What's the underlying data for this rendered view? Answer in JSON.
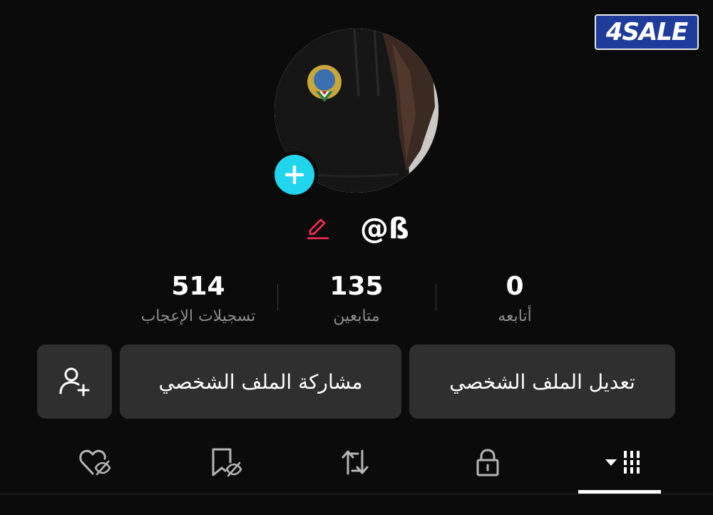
{
  "watermark": {
    "text": "4SALE"
  },
  "profile": {
    "username": "@ß",
    "avatar_icon": "profile-photo",
    "add_icon": "plus-icon",
    "edit_icon": "pencil-icon"
  },
  "stats": [
    {
      "value": "0",
      "label": "أتابعه"
    },
    {
      "value": "135",
      "label": "متابعين"
    },
    {
      "value": "514",
      "label": "تسجيلات الإعجاب"
    }
  ],
  "buttons": {
    "edit_profile": "تعديل الملف الشخصي",
    "share_profile": "مشاركة الملف الشخصي",
    "add_friend_icon": "add-user-icon"
  },
  "tabs": [
    {
      "icon": "grid-icon",
      "active": true
    },
    {
      "icon": "lock-icon",
      "active": false
    },
    {
      "icon": "repost-icon",
      "active": false
    },
    {
      "icon": "bookmark-hidden-icon",
      "active": false
    },
    {
      "icon": "heart-hidden-icon",
      "active": false
    }
  ],
  "colors": {
    "background": "#0b0b0b",
    "button_bg": "#2f2f2f",
    "accent_add": "#20d5ec",
    "edit_pencil": "#fe2c55",
    "muted_text": "#8c8c8c"
  }
}
